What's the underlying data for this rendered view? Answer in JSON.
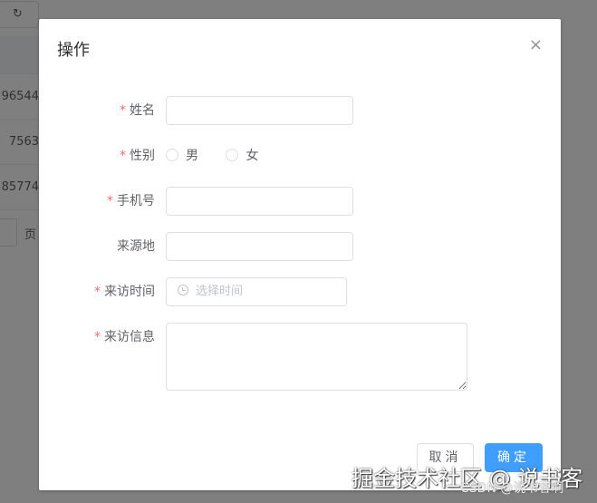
{
  "background": {
    "refresh_icon": "↻",
    "cells": [
      "96544",
      "7563",
      "85774"
    ],
    "pagination_suffix": "页"
  },
  "dialog": {
    "title": "操作",
    "close_icon": "×",
    "required_mark": "*",
    "fields": {
      "name": {
        "label": "姓名",
        "value": ""
      },
      "gender": {
        "label": "性别",
        "options": [
          "男",
          "女"
        ]
      },
      "phone": {
        "label": "手机号",
        "value": ""
      },
      "origin": {
        "label": "来源地",
        "value": ""
      },
      "visit_time": {
        "label": "来访时间",
        "placeholder": "选择时间"
      },
      "visit_info": {
        "label": "来访信息",
        "value": ""
      }
    },
    "cancel_label": "取消",
    "confirm_label": "确定"
  },
  "watermark": {
    "line1": "掘金技术社区 @ 说书客",
    "line2": "CSDN @说书客啊"
  }
}
